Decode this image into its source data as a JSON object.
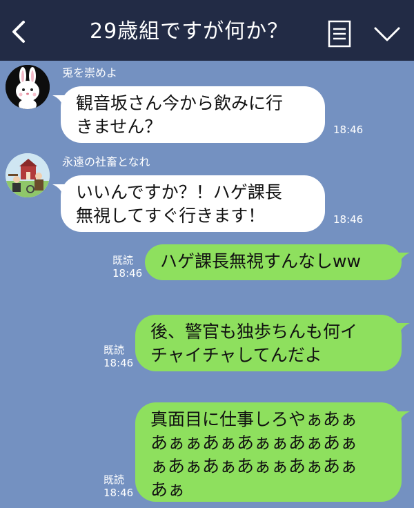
{
  "header": {
    "title": "29歳組ですが何か？",
    "back_icon": "chevron-left-icon",
    "menu_icon": "menu-lines-icon",
    "dropdown_icon": "chevron-down-icon",
    "background": "#222b45"
  },
  "colors": {
    "chat_background": "#7491c1",
    "incoming_bubble": "#ffffff",
    "outgoing_bubble": "#8ee05e"
  },
  "messages": [
    {
      "direction": "incoming",
      "sender": "兎を崇めよ",
      "avatar": "rabbit-avatar",
      "lines": [
        "観音坂さん今から飲みに行",
        "きません？"
      ],
      "time": "18:46"
    },
    {
      "direction": "incoming",
      "sender": "永遠の社畜となれ",
      "avatar": "farm-people-avatar",
      "lines": [
        "いいんですか？！ハゲ課長",
        "無視してすぐ行きます！"
      ],
      "time": "18:46"
    },
    {
      "direction": "outgoing",
      "read": "既読",
      "lines": [
        "ハゲ課長無視すんなしww"
      ],
      "time": "18:46"
    },
    {
      "direction": "outgoing",
      "read": "既読",
      "lines": [
        "後、警官も独歩ちんも何イ",
        "チャイチャしてんだよ"
      ],
      "time": "18:46"
    },
    {
      "direction": "outgoing",
      "read": "既読",
      "lines": [
        "真面目に仕事しろやぁあぁ",
        "あぁぁあぁあぁぁあぁあぁ",
        "ぁあぁあぁあぁぁあぁあぁ",
        "あぁ"
      ],
      "time": "18:46"
    }
  ]
}
